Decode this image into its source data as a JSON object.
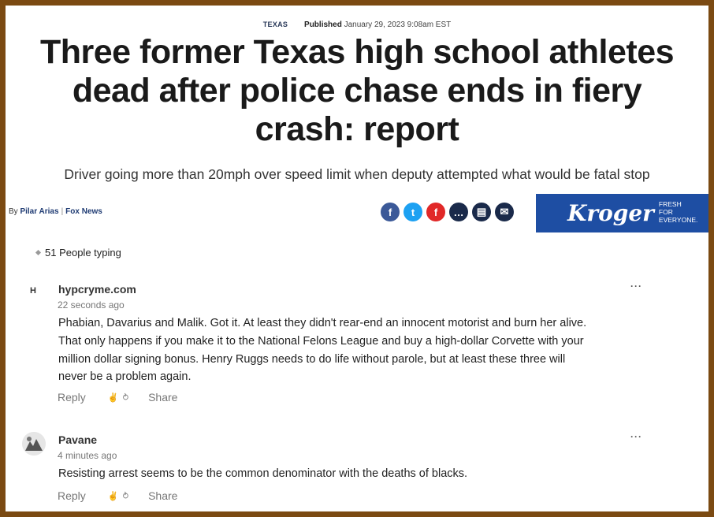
{
  "article": {
    "category": "TEXAS",
    "published_label": "Published",
    "published_date": "January 29, 2023 9:08am EST",
    "headline": "Three former Texas high school athletes dead after police chase ends in fiery crash: report",
    "subheadline": "Driver going more than 20mph over speed limit when deputy attempted what would be fatal stop",
    "byline_prefix": "By",
    "author": "Pilar Arias",
    "byline_separator": "|",
    "outlet": "Fox News"
  },
  "share": [
    {
      "name": "facebook",
      "glyph": "f",
      "color": "#3b5998"
    },
    {
      "name": "twitter",
      "glyph": "t",
      "color": "#1da1f2"
    },
    {
      "name": "flipboard",
      "glyph": "f",
      "color": "#e12828"
    },
    {
      "name": "comments",
      "glyph": "…",
      "color": "#1a2a4a"
    },
    {
      "name": "print",
      "glyph": "▤",
      "color": "#1a2a4a"
    },
    {
      "name": "email",
      "glyph": "✉",
      "color": "#1a2a4a"
    }
  ],
  "ad": {
    "brand": "Kroger",
    "tagline_1": "FRESH",
    "tagline_2": "FOR",
    "tagline_3": "EVERYONE.",
    "color": "#1e4ea3"
  },
  "typing_indicator": "51 People typing",
  "comments": [
    {
      "avatar_letter": "H",
      "user": "hypcryme.com",
      "time": "22 seconds ago",
      "text": "Phabian,  Davarius and Malik.  Got it. At least they didn't rear-end an innocent motorist and burn her alive.  That only happens if you make it to the National Felons League and buy a high-dollar Corvette with your million dollar signing bonus.  Henry Ruggs needs to do life without parole, but at least these three will never be a problem again.",
      "reply": "Reply",
      "share": "Share",
      "more": "···"
    },
    {
      "avatar_letter": "",
      "user": "Pavane",
      "time": "4 minutes ago",
      "text": "Resisting arrest seems to be the common denominator with the deaths of blacks.",
      "reply": "Reply",
      "share": "Share",
      "more": "···"
    }
  ],
  "colors": {
    "frame": "#7b4a12",
    "link": "#1f3b73"
  }
}
